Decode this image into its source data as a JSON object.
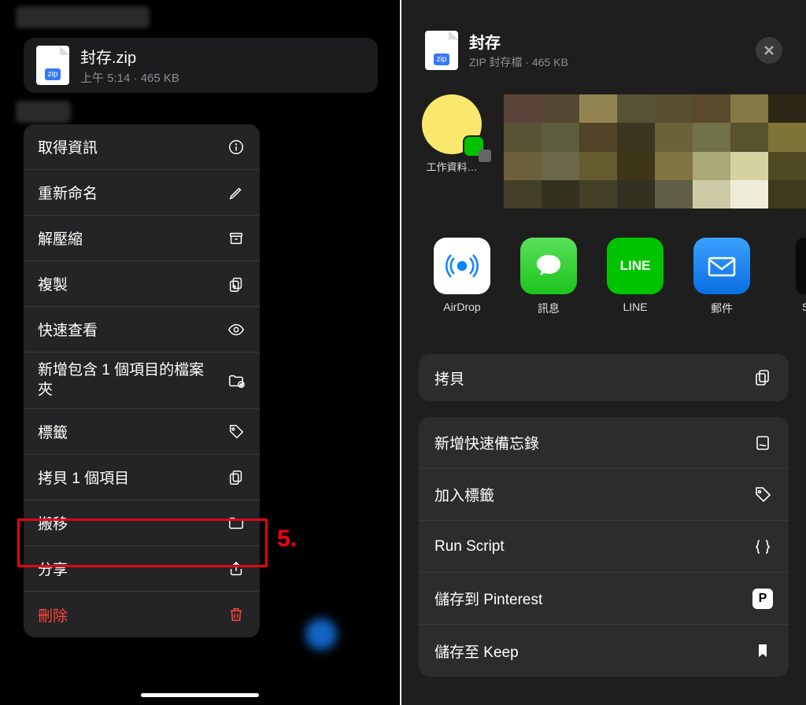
{
  "left": {
    "file": {
      "name": "封存.zip",
      "subtitle": "上午 5:14 · 465 KB",
      "zip_badge": "zip"
    },
    "context_menu": [
      {
        "label": "取得資訊",
        "icon": "info"
      },
      {
        "label": "重新命名",
        "icon": "pencil"
      },
      {
        "label": "解壓縮",
        "icon": "archive"
      },
      {
        "label": "複製",
        "icon": "duplicate"
      },
      {
        "label": "快速查看",
        "icon": "eye"
      },
      {
        "label": "新增包含 1 個項目的檔案夾",
        "icon": "folder-plus"
      },
      {
        "label": "標籤",
        "icon": "tag"
      },
      {
        "label": "拷貝 1 個項目",
        "icon": "copy"
      },
      {
        "label": "搬移",
        "icon": "folder"
      },
      {
        "label": "分享",
        "icon": "share"
      },
      {
        "label": "刪除",
        "icon": "trash",
        "destructive": true
      }
    ],
    "annotation": "5."
  },
  "right": {
    "header": {
      "title": "封存",
      "subtitle": "ZIP 封存檔 · 465 KB",
      "zip_badge": "zip"
    },
    "airdrop_target": "工作資料…",
    "apps": [
      {
        "label": "AirDrop",
        "kind": "airdrop"
      },
      {
        "label": "訊息",
        "kind": "msg"
      },
      {
        "label": "LINE",
        "kind": "line",
        "text": "LINE"
      },
      {
        "label": "郵件",
        "kind": "mail"
      },
      {
        "label": "Sc",
        "kind": "more"
      }
    ],
    "copy_action": "拷貝",
    "actions": [
      {
        "label": "新增快速備忘錄",
        "icon": "note"
      },
      {
        "label": "加入標籤",
        "icon": "tag"
      },
      {
        "label": "Run Script",
        "icon": "braces"
      },
      {
        "label": "儲存到 Pinterest",
        "icon": "pinterest"
      },
      {
        "label": "儲存至 Keep",
        "icon": "bookmark"
      }
    ],
    "mosaic_colors": [
      "#5b443a",
      "#534832",
      "#938453",
      "#565235",
      "#584f30",
      "#5a4a2b",
      "#837944",
      "#2c2716",
      "#5a5234",
      "#5d5c3c",
      "#504328",
      "#3d3520",
      "#6a6238",
      "#71724a",
      "#58532c",
      "#807338",
      "#6b603b",
      "#6b6849",
      "#655d30",
      "#3d3617",
      "#817342",
      "#a9a978",
      "#d6d2a0",
      "#504a22",
      "#444028",
      "#333120",
      "#444028",
      "#333120",
      "#5f5f47",
      "#cdcba5",
      "#eeedd7",
      "#3f3a1b"
    ]
  }
}
